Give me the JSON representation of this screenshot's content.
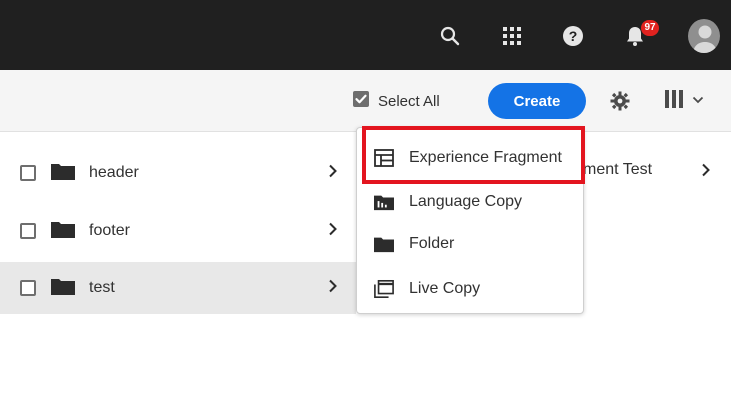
{
  "shell": {
    "icons": [
      "search-icon",
      "apps-grid-icon",
      "help-icon",
      "notifications-bell-icon",
      "user-avatar"
    ],
    "notification_count": "97",
    "background": "#202020",
    "badge_color": "#e0221f"
  },
  "actionbar": {
    "select_all_label": "Select All",
    "create_label": "Create",
    "accent": "#1473e6"
  },
  "rows": [
    {
      "label": "header",
      "selected": false
    },
    {
      "label": "footer",
      "selected": false
    },
    {
      "label": "test",
      "selected": true
    }
  ],
  "right_column": {
    "label_fragment": "ment Test"
  },
  "create_menu": {
    "items": [
      {
        "label": "Experience Fragment",
        "icon": "experience-fragment-icon"
      },
      {
        "label": "Language Copy",
        "icon": "language-copy-icon"
      },
      {
        "label": "Folder",
        "icon": "folder-icon"
      },
      {
        "label": "Live Copy",
        "icon": "live-copy-icon"
      }
    ],
    "highlight_color": "#e3151f"
  }
}
